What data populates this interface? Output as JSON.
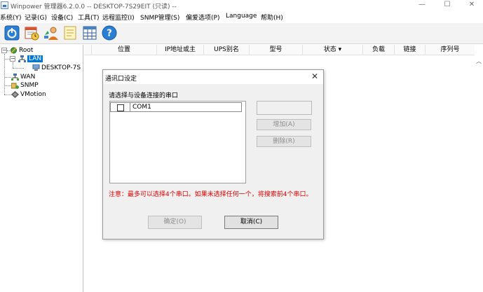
{
  "window": {
    "title": "Winpower 管理器6.2.0.0 -- DESKTOP-7S29EIT (只读) --",
    "min_glyph": "—",
    "max_glyph": "☐",
    "close_glyph": "✕"
  },
  "menu": [
    {
      "label": "系统(Y)"
    },
    {
      "label": "记录(G)"
    },
    {
      "label": "设备(C)"
    },
    {
      "label": "工具(T)"
    },
    {
      "label": "远程监控(I)"
    },
    {
      "label": "SNMP管理(S)"
    },
    {
      "label": "偏爱选项(P)"
    },
    {
      "label": "Language"
    },
    {
      "label": "帮助(H)"
    }
  ],
  "toolbar": {
    "icons": [
      "power-icon",
      "calendar-clock-icon",
      "user-network-icon",
      "notes-icon",
      "grid-icon",
      "help-icon"
    ]
  },
  "tree": {
    "root": "Root",
    "lan": "LAN",
    "lan_child": "DESKTOP-7S",
    "wan": "WAN",
    "snmp": "SNMP",
    "vmotion": "VMotion"
  },
  "columns": [
    {
      "label": "位置"
    },
    {
      "label": "IP地址或主"
    },
    {
      "label": "UPS别名"
    },
    {
      "label": "型号"
    },
    {
      "label": "状态 ▾"
    },
    {
      "label": "负载"
    },
    {
      "label": "链接"
    },
    {
      "label": "序列号"
    }
  ],
  "dialog": {
    "title": "通讯口设定",
    "close_glyph": "✕",
    "prompt": "请选择与设备连接的串口",
    "ports": [
      {
        "label": "COM1",
        "checked": false
      }
    ],
    "add_label": "增加(A)",
    "delete_label": "删除(R)",
    "note": "注意：最多可以选择4个串口。如果未选择任何一个，将搜索前4个串口。",
    "ok_label": "确定(O)",
    "cancel_label": "取消(C)"
  },
  "colors": {
    "accent": "#0078d7",
    "warning_text": "#e00000"
  }
}
